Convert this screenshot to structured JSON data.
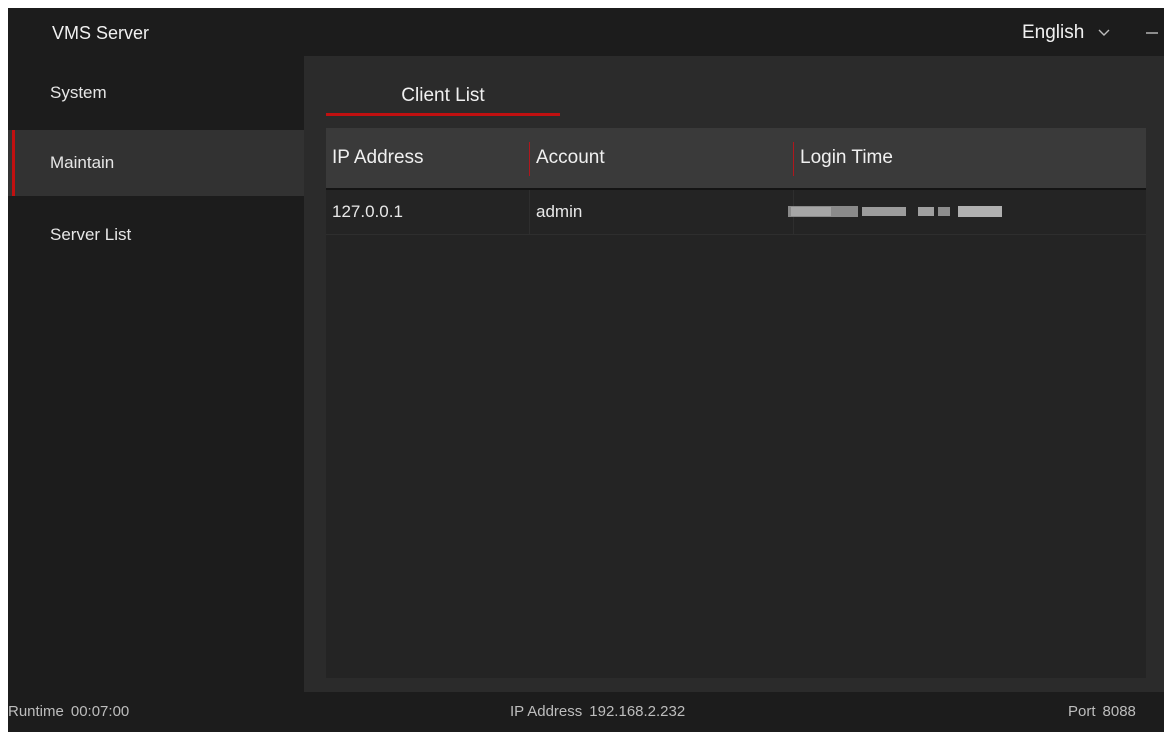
{
  "app": {
    "title": "VMS Server",
    "language": "English"
  },
  "icons": {
    "language_dropdown": "chevron-down-icon",
    "minimize": "minimize-icon"
  },
  "colors": {
    "accent": "#c01010",
    "background": "#1c1c1c",
    "panel": "#2b2b2b",
    "table_header": "#3a3a3a"
  },
  "sidebar": {
    "items": [
      {
        "label": "System",
        "active": false
      },
      {
        "label": "Maintain",
        "active": true
      },
      {
        "label": "Server List",
        "active": false
      }
    ]
  },
  "main": {
    "tabs": [
      {
        "label": "Client List",
        "active": true
      }
    ],
    "table": {
      "columns": [
        "IP Address",
        "Account",
        "Login Time"
      ],
      "rows": [
        {
          "ip": "127.0.0.1",
          "account": "admin",
          "login_time": ""
        }
      ]
    }
  },
  "status": {
    "runtime_label": "Runtime",
    "runtime_value": "00:07:00",
    "ip_label": "IP Address",
    "ip_value": "192.168.2.232",
    "port_label": "Port",
    "port_value": "8088"
  }
}
